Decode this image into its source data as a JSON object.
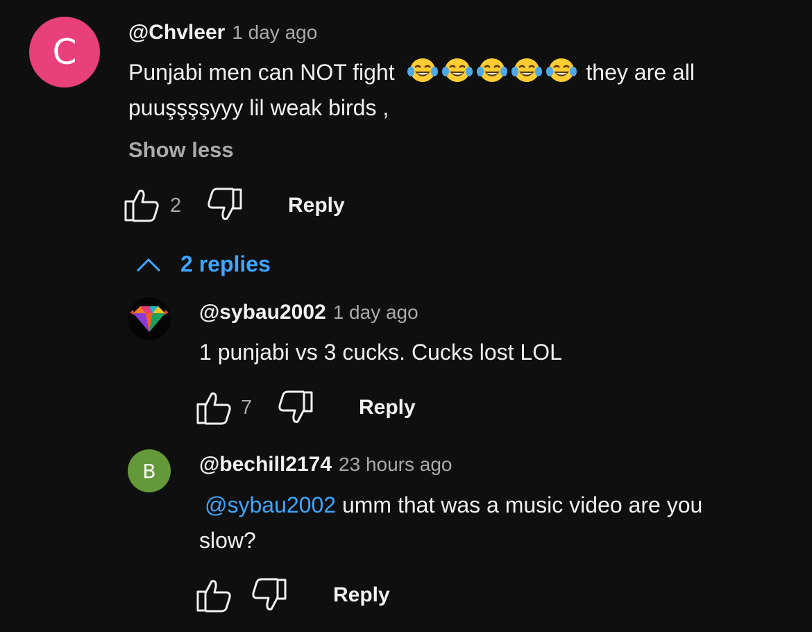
{
  "comment": {
    "avatar_letter": "C",
    "avatar_color": "#e8407a",
    "handle": "@Chvleer",
    "time": "1 day ago",
    "text_line1": "Punjabi men can NOT fight",
    "emoji_icons": [
      "face-with-tears-of-joy-icon",
      "face-with-tears-of-joy-icon",
      "face-with-tears-of-joy-icon",
      "face-with-tears-of-joy-icon",
      "face-with-tears-of-joy-icon"
    ],
    "text_line1_end": "they are all",
    "text_line2": "puuşşşşyyy lil weak birds ,",
    "show_less": "Show less",
    "like_count": "2",
    "reply_label": "Reply"
  },
  "replies_toggle": {
    "label": "2 replies",
    "icon": "chevron-up-icon",
    "color": "#3ea6ff"
  },
  "replies": [
    {
      "avatar_icon": "diamond-avatar-icon",
      "handle": "@sybau2002",
      "time": "1 day ago",
      "text": "1 punjabi vs 3 cucks. Cucks lost LOL",
      "like_count": "7",
      "reply_label": "Reply"
    },
    {
      "avatar_letter": "B",
      "avatar_color": "#64993a",
      "handle": "@bechill2174",
      "time": "23 hours ago",
      "mention": "@sybau2002",
      "text_line1": "umm that was a music video are you",
      "text_line2": "slow?",
      "reply_label": "Reply"
    }
  ]
}
